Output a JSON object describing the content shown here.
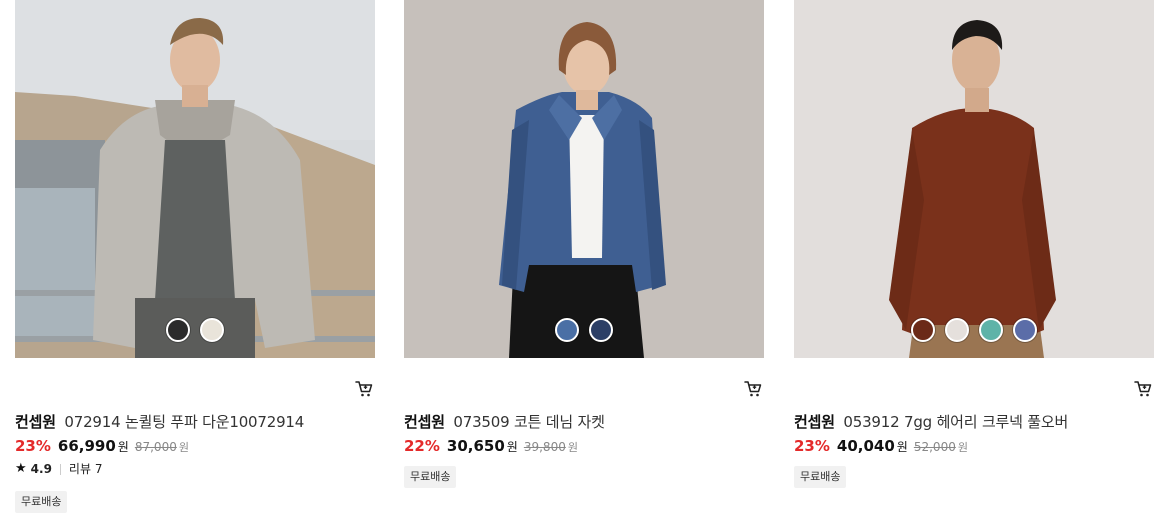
{
  "products": [
    {
      "image_desc": "puffer-jacket-photo",
      "swatch_colors": [
        "#2b2b2b",
        "#e9e4da"
      ],
      "brand": "컨셉원",
      "name": "072914 논퀼팅 푸파 다운10072914",
      "discount": "23%",
      "price": "66,990",
      "currency": "원",
      "original_price": "87,000",
      "rating": "4.9",
      "review_label": "리뷰 7",
      "badge": "무료배송"
    },
    {
      "image_desc": "denim-jacket-photo",
      "swatch_colors": [
        "#4a6fa5",
        "#2c3f66"
      ],
      "brand": "컨셉원",
      "name": "073509 코튼 데님 자켓",
      "discount": "22%",
      "price": "30,650",
      "currency": "원",
      "original_price": "39,800",
      "badge": "무료배송"
    },
    {
      "image_desc": "hairy-sweater-photo",
      "swatch_colors": [
        "#6b2a18",
        "#e5e0dc",
        "#5fb3a8",
        "#5b6da8"
      ],
      "brand": "컨셉원",
      "name": "053912 7gg 헤어리 크루넥 풀오버",
      "discount": "23%",
      "price": "40,040",
      "currency": "원",
      "original_price": "52,000",
      "badge": "무료배송"
    }
  ],
  "colors": {
    "discount": "#e42a2a",
    "badge_bg": "#f1f1f1"
  }
}
